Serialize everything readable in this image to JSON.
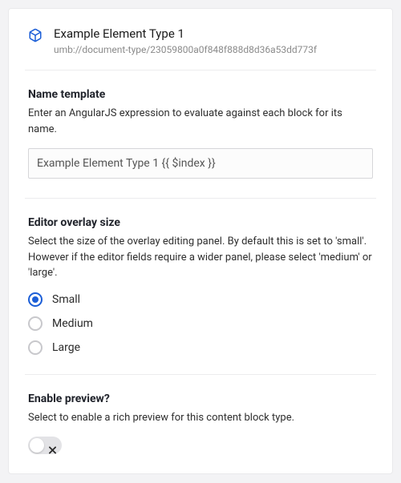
{
  "header": {
    "icon": "box-icon",
    "title": "Example Element Type 1",
    "uri": "umb://document-type/23059800a0f848f888d8d36a53dd773f"
  },
  "nameTemplate": {
    "title": "Name template",
    "description": "Enter an AngularJS expression to evaluate against each block for its name.",
    "value": "Example Element Type 1 {{ $index }}"
  },
  "overlaySize": {
    "title": "Editor overlay size",
    "description": "Select the size of the overlay editing panel. By default this is set to 'small'. However if the editor fields require a wider panel, please select 'medium' or 'large'.",
    "options": [
      {
        "label": "Small",
        "selected": true
      },
      {
        "label": "Medium",
        "selected": false
      },
      {
        "label": "Large",
        "selected": false
      }
    ]
  },
  "preview": {
    "title": "Enable preview?",
    "description": "Select to enable a rich preview for this content block type.",
    "enabled": false
  },
  "colors": {
    "accent": "#1b5ed7"
  }
}
